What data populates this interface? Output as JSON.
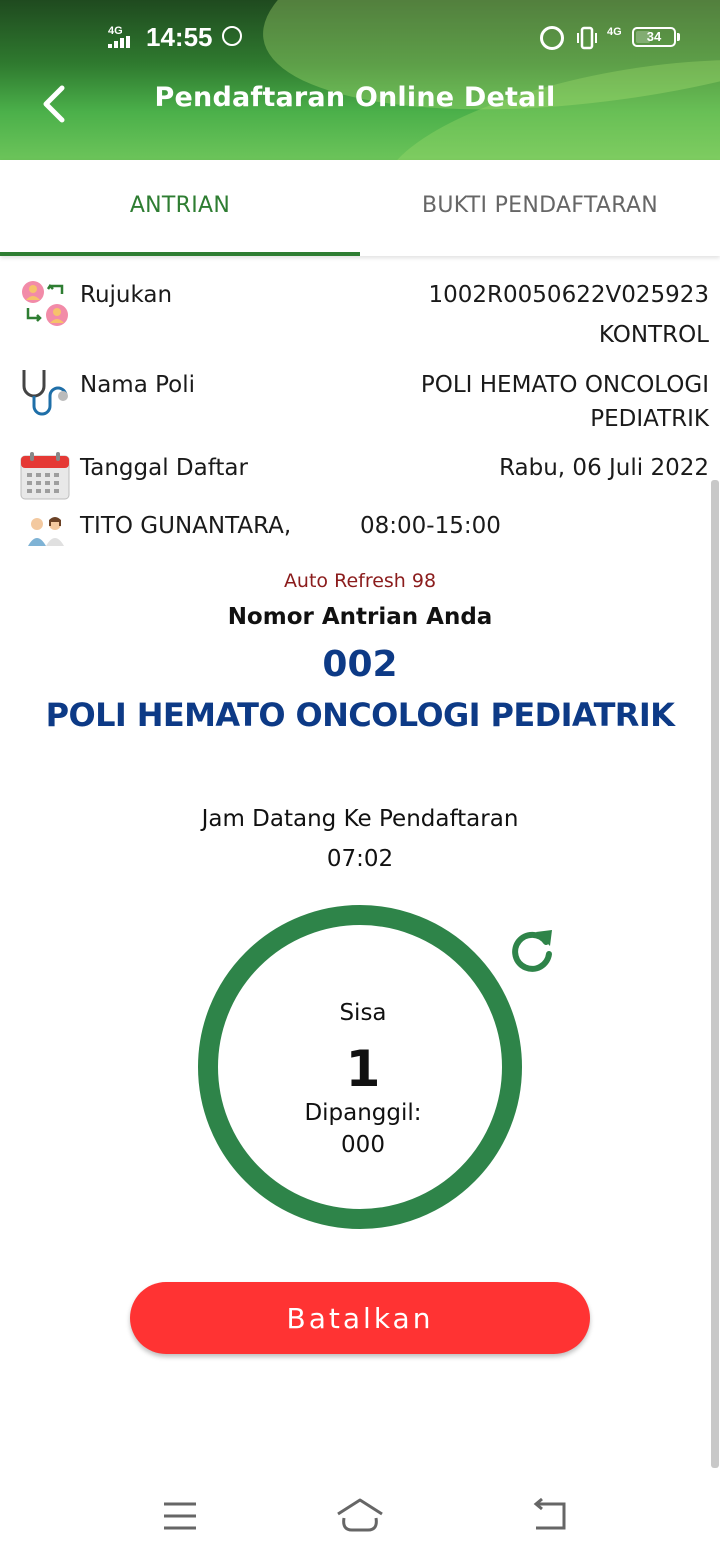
{
  "status_bar": {
    "network": "4G",
    "time": "14:55",
    "network_right": "4G",
    "battery": "34"
  },
  "app_bar": {
    "title": "Pendaftaran Online Detail",
    "back_icon": "chevron-left-icon"
  },
  "tabs": [
    {
      "label": "ANTRIAN",
      "active": true
    },
    {
      "label": "BUKTI PENDAFTARAN",
      "active": false
    }
  ],
  "info": {
    "rujukan": {
      "label": "Rujukan",
      "value": "1002R0050622V025923",
      "value2": "KONTROL",
      "icon": "referral-icon"
    },
    "nama_poli": {
      "label": "Nama Poli",
      "value": "POLI HEMATO ONCOLOGI",
      "value2": "PEDIATRIK",
      "icon": "stethoscope-icon"
    },
    "tanggal_daftar": {
      "label": "Tanggal Daftar",
      "value": "Rabu, 06 Juli 2022",
      "icon": "calendar-icon"
    },
    "dokter": {
      "name": "TITO GUNANTARA,",
      "hours": "08:00-15:00",
      "icon": "doctors-icon"
    }
  },
  "queue": {
    "auto_refresh": "Auto Refresh 98",
    "label": "Nomor Antrian Anda",
    "number": "002",
    "poli": "POLI HEMATO ONCOLOGI PEDIATRIK",
    "arrival_label": "Jam Datang Ke Pendaftaran",
    "arrival_time": "07:02",
    "sisa_label": "Sisa",
    "sisa_value": "1",
    "called_label": "Dipanggil:",
    "called_value": "000"
  },
  "actions": {
    "cancel_label": "Batalkan"
  },
  "colors": {
    "primary_green": "#2e7d32",
    "ring_green": "#2e8449",
    "queue_blue": "#0d3a86",
    "refresh_red": "#8b1c1c",
    "cancel_red": "#ff3333"
  },
  "nav_bar": {
    "icons": [
      "menu-icon",
      "home-icon",
      "back-icon"
    ]
  }
}
